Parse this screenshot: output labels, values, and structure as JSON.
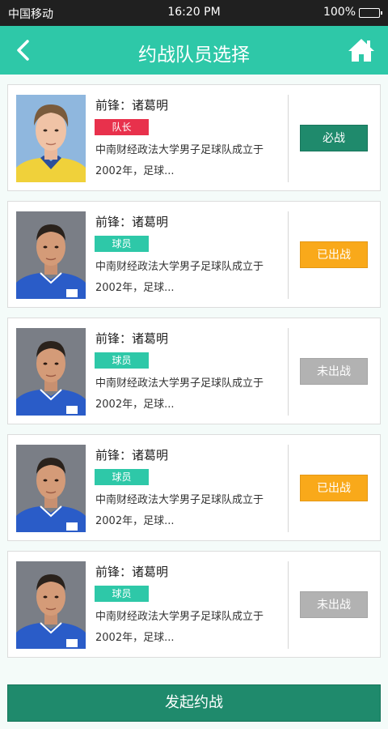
{
  "status_bar": {
    "carrier": "中国移动",
    "time": "16:20 PM",
    "battery": "100%"
  },
  "header": {
    "title": "约战队员选择",
    "back_icon": "back-arrow-icon",
    "home_icon": "home-icon"
  },
  "players": [
    {
      "name": "前锋：诸葛明",
      "badge": "队长",
      "badge_type": "captain",
      "desc": "中南财经政法大学男子足球队成立于2002年，足球...",
      "action": "必战",
      "action_type": "green",
      "photo": "portrait-yellow-jersey"
    },
    {
      "name": "前锋：诸葛明",
      "badge": "球员",
      "badge_type": "member",
      "desc": "中南财经政法大学男子足球队成立于2002年，足球...",
      "action": "已出战",
      "action_type": "orange",
      "photo": "portrait-blue-jersey"
    },
    {
      "name": "前锋：诸葛明",
      "badge": "球员",
      "badge_type": "member",
      "desc": "中南财经政法大学男子足球队成立于2002年，足球...",
      "action": "未出战",
      "action_type": "gray",
      "photo": "portrait-blue-jersey"
    },
    {
      "name": "前锋：诸葛明",
      "badge": "球员",
      "badge_type": "member",
      "desc": "中南财经政法大学男子足球队成立于2002年，足球...",
      "action": "已出战",
      "action_type": "orange",
      "photo": "portrait-blue-jersey"
    },
    {
      "name": "前锋：诸葛明",
      "badge": "球员",
      "badge_type": "member",
      "desc": "中南财经政法大学男子足球队成立于2002年，足球...",
      "action": "未出战",
      "action_type": "gray",
      "photo": "portrait-blue-jersey"
    }
  ],
  "submit_label": "发起约战",
  "colors": {
    "primary": "#2ec8a8",
    "dark_green": "#1f8a6c",
    "captain_red": "#e8314c",
    "orange": "#f9a91a",
    "gray": "#b2b2b2"
  }
}
